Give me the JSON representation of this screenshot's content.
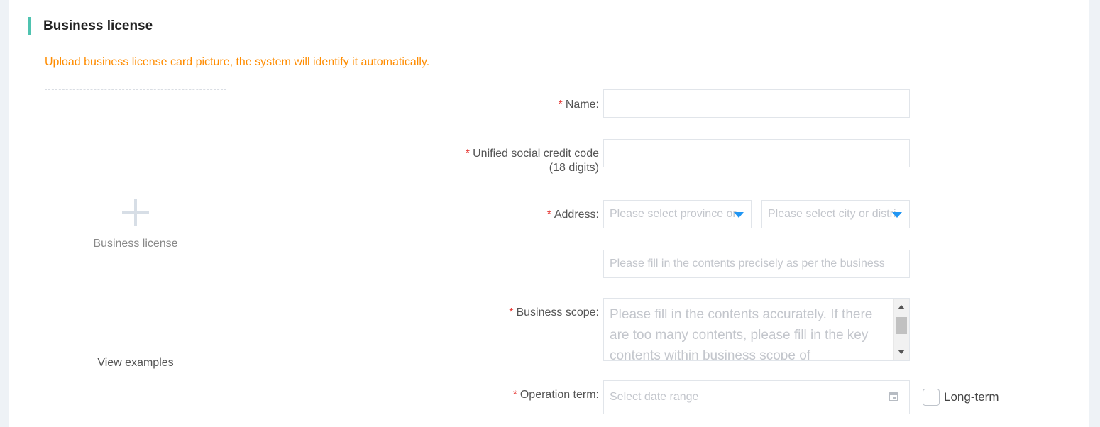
{
  "section": {
    "title": "Business license",
    "notice": "Upload business license card picture, the system will identify it automatically."
  },
  "upload": {
    "label": "Business license",
    "view_examples": "View examples",
    "icon": "plus-icon"
  },
  "form": {
    "required_mark": "*",
    "name": {
      "label": "Name:",
      "value": ""
    },
    "credit_code": {
      "label_line1": "Unified social credit code",
      "label_line2": "(18 digits)",
      "value": ""
    },
    "address": {
      "label": "Address:",
      "province_placeholder": "Please select province or",
      "city_placeholder": "Please select city or distri",
      "detail_placeholder": "Please fill in the contents precisely as per the business",
      "caret_icon": "caret-down-icon"
    },
    "business_scope": {
      "label": "Business scope:",
      "placeholder": "Please fill in the contents accurately. If there are too many contents, please fill in the key contents within business scope of"
    },
    "operation_term": {
      "label": "Operation term:",
      "placeholder": "Select date range",
      "calendar_icon": "calendar-icon",
      "long_term_label": "Long-term",
      "long_term_checked": false
    }
  },
  "colors": {
    "accent_bar": "#4fc3b0",
    "notice": "#ff8c00",
    "required": "#e53935",
    "caret": "#2196f3"
  }
}
